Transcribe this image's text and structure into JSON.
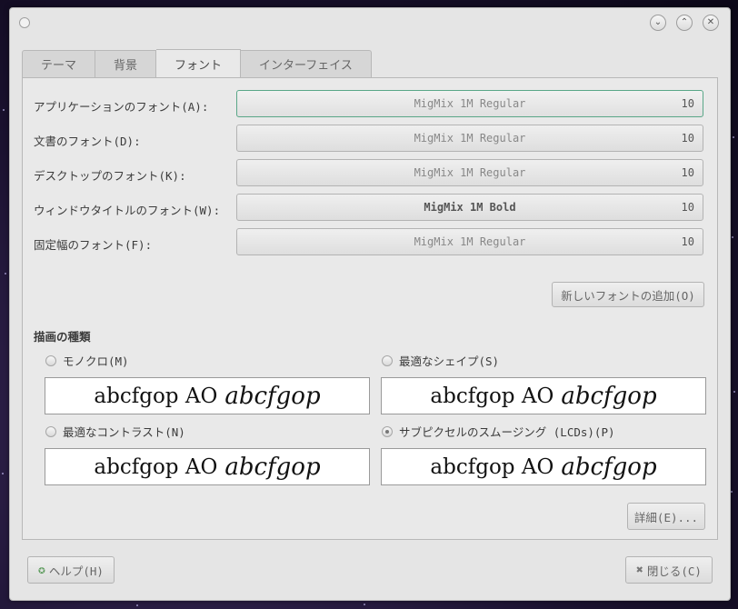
{
  "titlebar": {
    "minimize_icon": "chevron-down-icon",
    "maximize_icon": "chevron-up-icon",
    "close_icon": "close-icon",
    "minimize_glyph": "⌄",
    "maximize_glyph": "⌃",
    "close_glyph": "✕"
  },
  "tabs": [
    {
      "label": "テーマ"
    },
    {
      "label": "背景"
    },
    {
      "label": "フォント",
      "active": true
    },
    {
      "label": "インターフェイス"
    }
  ],
  "fonts": [
    {
      "label": "アプリケーションのフォント(A):",
      "font": "MigMix 1M Regular",
      "size": "10",
      "focused": true
    },
    {
      "label": "文書のフォント(D):",
      "font": "MigMix 1M Regular",
      "size": "10"
    },
    {
      "label": "デスクトップのフォント(K):",
      "font": "MigMix 1M Regular",
      "size": "10"
    },
    {
      "label": "ウィンドウタイトルのフォント(W):",
      "font": "MigMix 1M Bold",
      "size": "10",
      "bold": true
    },
    {
      "label": "固定幅のフォント(F):",
      "font": "MigMix 1M Regular",
      "size": "10"
    }
  ],
  "add_font_button": "新しいフォントの追加(O)",
  "rendering": {
    "title": "描画の種類",
    "options": [
      {
        "label": "モノクロ(M)",
        "checked": false
      },
      {
        "label": "最適なシェイプ(S)",
        "checked": false
      },
      {
        "label": "最適なコントラスト(N)",
        "checked": false
      },
      {
        "label": "サブピクセルのスムージング (LCDs)(P)",
        "checked": true
      }
    ],
    "preview_regular": "abcfgop AO",
    "preview_italic": "abcfgop"
  },
  "details_button": "詳細(E)...",
  "help_button": {
    "label": "ヘルプ(H)",
    "icon": "lifebuoy-icon",
    "glyph": "✪"
  },
  "close_button": {
    "label": "閉じる(C)",
    "icon": "close-icon",
    "glyph": "✖"
  },
  "colors": {
    "focus_border": "#5aa788",
    "window_bg": "#e5e5e5"
  }
}
